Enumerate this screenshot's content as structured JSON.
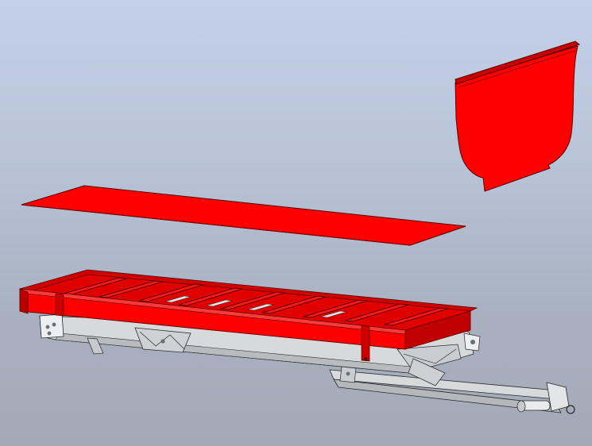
{
  "viewport": {
    "background_top": "#c4d0e6",
    "background_bottom": "#a3a9b6"
  },
  "model": {
    "colors": {
      "red": "#ff0000",
      "red_dark": "#c80000",
      "red_edge": "#5a0000",
      "steel": "#d7d9db",
      "steel_light": "#eceeef",
      "steel_dark": "#9da1a5",
      "edge": "#2a2a2a"
    },
    "parts": [
      "front-panel",
      "floor-plate",
      "trailer-body-frame",
      "chassis-frame",
      "drawbar"
    ]
  }
}
